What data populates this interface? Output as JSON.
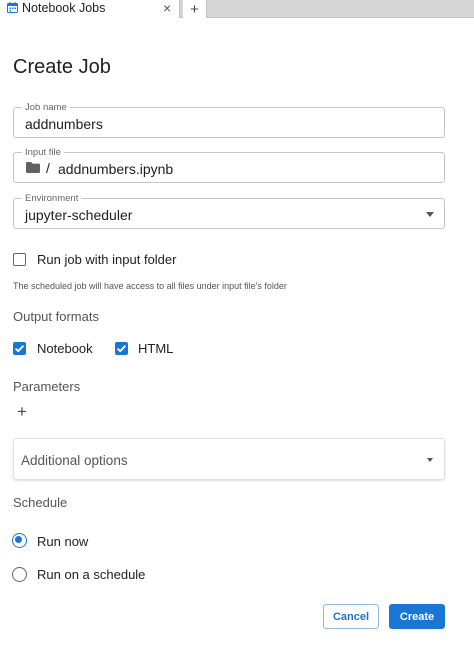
{
  "tabs": {
    "active_label": "Notebook Jobs",
    "close_glyph": "×",
    "add_glyph": "+",
    "icon": "calendar-icon"
  },
  "page": {
    "title": "Create Job"
  },
  "form": {
    "job_name": {
      "label": "Job name",
      "value": "addnumbers"
    },
    "input_file": {
      "label": "Input file",
      "separator": "/",
      "value": "addnumbers.ipynb",
      "icon": "folder-icon"
    },
    "environment": {
      "label": "Environment",
      "value": "jupyter-scheduler"
    },
    "input_folder": {
      "label": "Run job with input folder",
      "checked": false,
      "helper": "The scheduled job will have access to all files under input file's folder"
    },
    "output_formats": {
      "label": "Output formats",
      "options": [
        {
          "label": "Notebook",
          "checked": true
        },
        {
          "label": "HTML",
          "checked": true
        }
      ]
    },
    "parameters": {
      "label": "Parameters",
      "add_glyph": "+"
    },
    "additional_options": {
      "label": "Additional options"
    },
    "schedule": {
      "label": "Schedule",
      "options": [
        {
          "label": "Run now",
          "selected": true
        },
        {
          "label": "Run on a schedule",
          "selected": false
        }
      ]
    }
  },
  "actions": {
    "cancel_label": "Cancel",
    "create_label": "Create"
  },
  "colors": {
    "accent": "#1976d2",
    "border": "#c4c4c4"
  }
}
